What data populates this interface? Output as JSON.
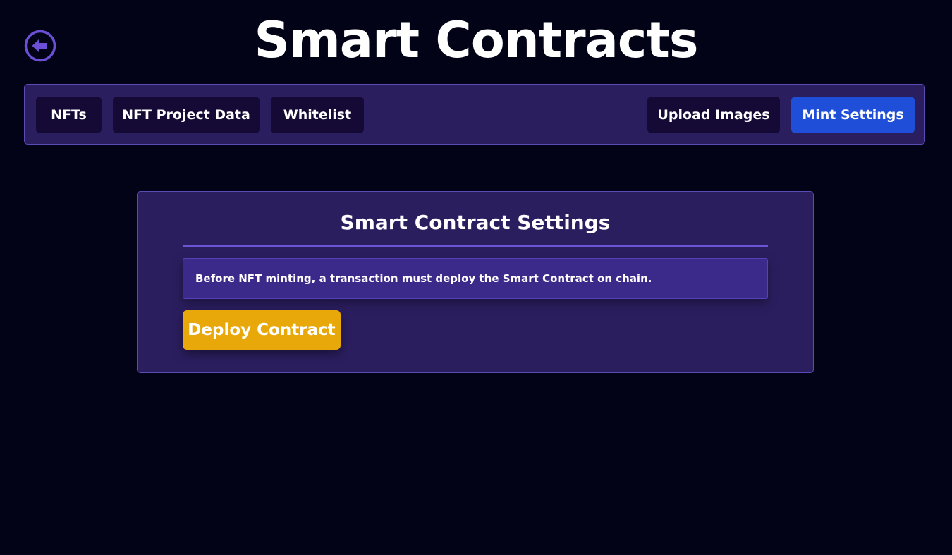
{
  "header": {
    "title": "Smart Contracts",
    "back_icon": "arrow-left-circle-icon"
  },
  "nav": {
    "left_tabs": [
      {
        "label": "NFTs"
      },
      {
        "label": "NFT Project Data"
      },
      {
        "label": "Whitelist"
      }
    ],
    "right_tabs": [
      {
        "label": "Upload Images"
      },
      {
        "label": "Mint Settings",
        "active": true
      }
    ]
  },
  "settings": {
    "title": "Smart Contract Settings",
    "notice": "Before NFT minting, a transaction must deploy the Smart Contract on chain.",
    "deploy_button": "Deploy Contract"
  },
  "colors": {
    "background": "#020316",
    "panel": "#2b1e5f",
    "panel_border": "#5b4bb7",
    "nav_button": "#150a35",
    "active_tab": "#1f4fd8",
    "accent_purple": "#6b57d6",
    "notice_bg": "#3c2a8a",
    "deploy_button": "#e8a80a"
  }
}
